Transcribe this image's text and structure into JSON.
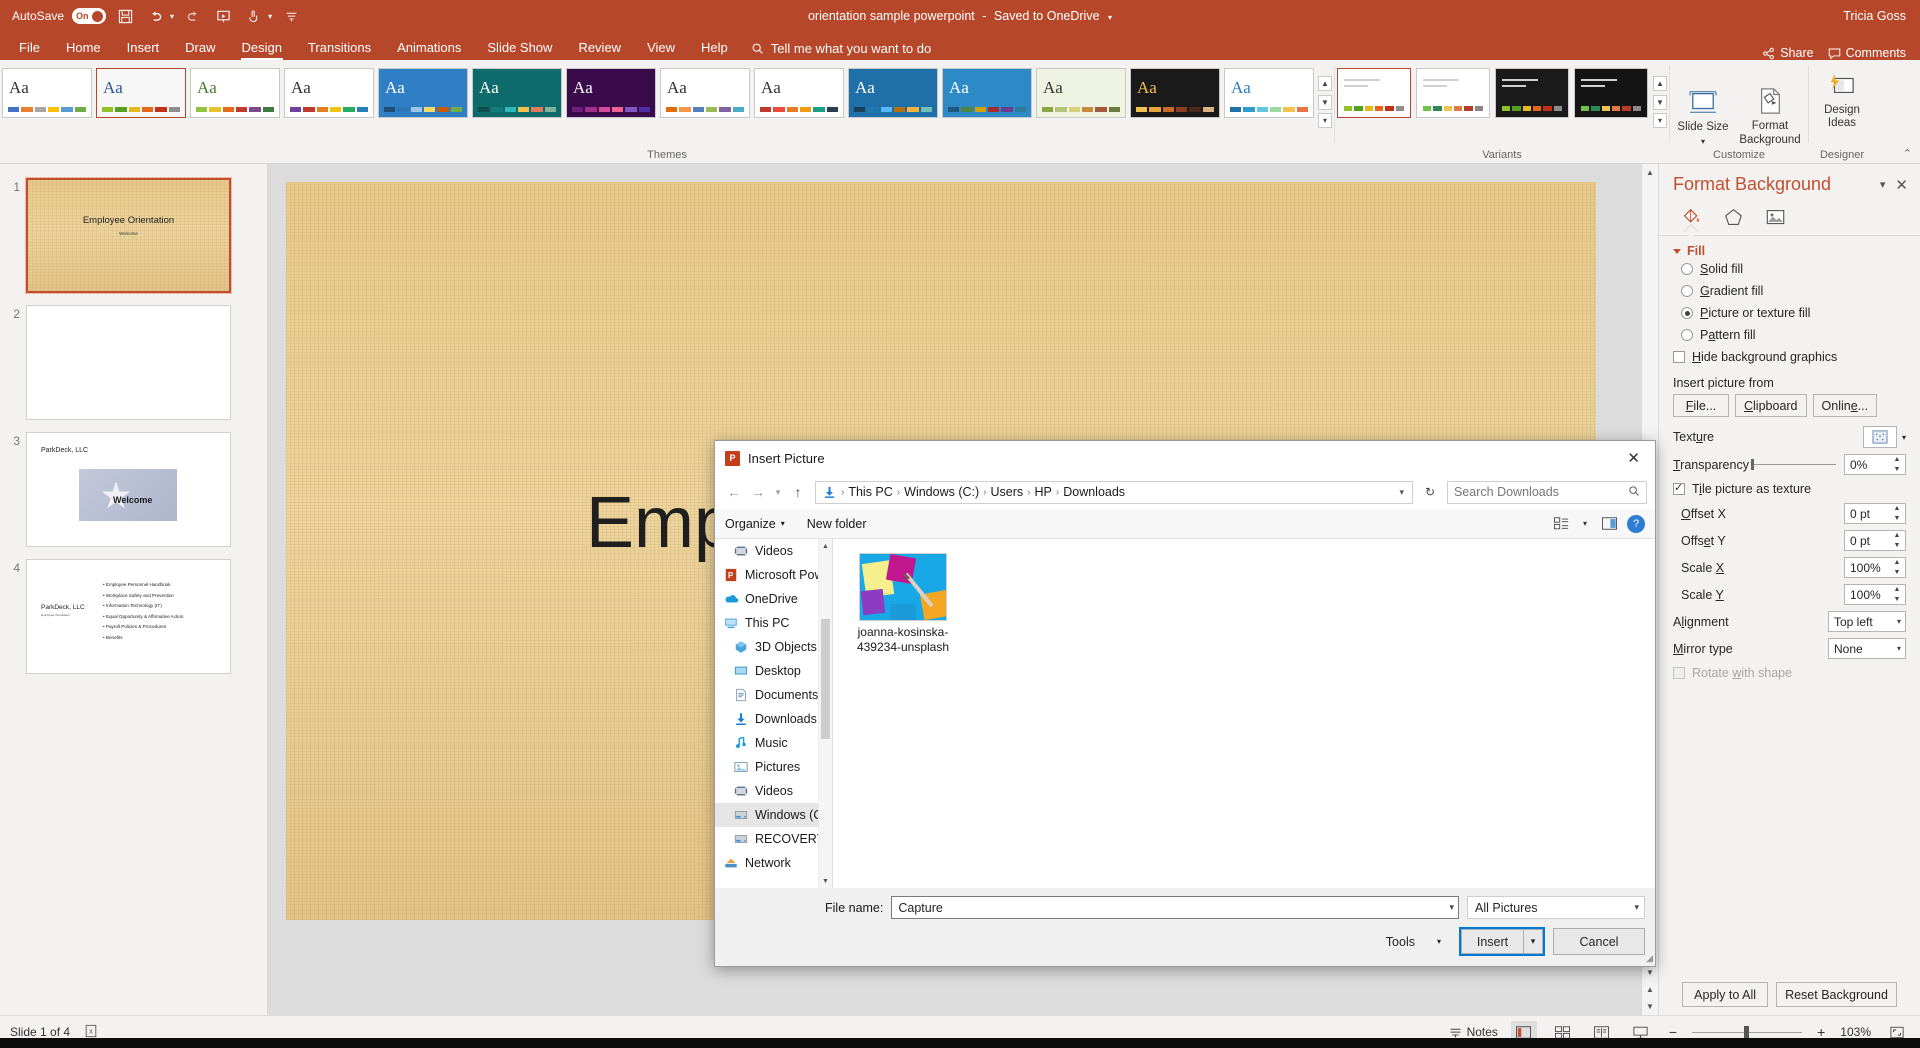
{
  "titlebar": {
    "autosave_label": "AutoSave",
    "autosave_state": "On",
    "document_title": "orientation sample powerpoint",
    "save_state": "Saved to OneDrive",
    "user_name": "Tricia Goss",
    "qat": [
      {
        "name": "save-icon",
        "glyph": "ὋE"
      },
      {
        "name": "undo-icon",
        "glyph": "↶"
      },
      {
        "name": "redo-icon",
        "glyph": "↻"
      },
      {
        "name": "start-presentation-icon",
        "glyph": "▣"
      },
      {
        "name": "touch-mode-icon",
        "glyph": "☝"
      },
      {
        "name": "customize-qat-icon",
        "glyph": "☰"
      }
    ]
  },
  "ribbon": {
    "tabs": [
      {
        "label": "File",
        "active": false
      },
      {
        "label": "Home",
        "active": false
      },
      {
        "label": "Insert",
        "active": false
      },
      {
        "label": "Draw",
        "active": false
      },
      {
        "label": "Design",
        "active": true
      },
      {
        "label": "Transitions",
        "active": false
      },
      {
        "label": "Animations",
        "active": false
      },
      {
        "label": "Slide Show",
        "active": false
      },
      {
        "label": "Review",
        "active": false
      },
      {
        "label": "View",
        "active": false
      },
      {
        "label": "Help",
        "active": false
      }
    ],
    "tellme_placeholder": "Tell me what you want to do",
    "share_label": "Share",
    "comments_label": "Comments",
    "groups": {
      "themes_label": "Themes",
      "variants_label": "Variants",
      "customize_label": "Customize",
      "designer_label": "Designer"
    },
    "buttons": {
      "slide_size": "Slide Size",
      "format_background": "Format Background",
      "design_ideas": "Design Ideas"
    },
    "themes": [
      {
        "name": "office-theme",
        "aa": "Aa",
        "bg": "#ffffff",
        "fg": "#333333",
        "colors": [
          "#4472c4",
          "#ed7d31",
          "#a5a5a5",
          "#ffc000",
          "#5b9bd5",
          "#70ad47"
        ],
        "selected": false
      },
      {
        "name": "facet-theme",
        "aa": "Aa",
        "bg": "#f7f7f7",
        "fg": "#2b579a",
        "colors": [
          "#90c226",
          "#54a021",
          "#e6b91e",
          "#e76618",
          "#c42f1a",
          "#918b8b"
        ],
        "selected": true
      },
      {
        "name": "berlin-theme",
        "aa": "Aa",
        "bg": "#ffffff",
        "fg": "#4a7a2c",
        "colors": [
          "#8ec63f",
          "#e8c32a",
          "#e56a19",
          "#c0392b",
          "#7a4b8c",
          "#3f7a3f"
        ],
        "selected": false
      },
      {
        "name": "celestial-theme",
        "aa": "Aa",
        "bg": "#ffffff",
        "fg": "#333333",
        "colors": [
          "#6f42a0",
          "#c0392b",
          "#e67e22",
          "#f1c40f",
          "#27ae60",
          "#2980b9"
        ],
        "selected": false
      },
      {
        "name": "dots-theme",
        "aa": "Aa",
        "bg": "#2f7ec6",
        "fg": "#ffffff",
        "colors": [
          "#1f4e79",
          "#2e75b6",
          "#9dc3e6",
          "#ffd966",
          "#c55a11",
          "#70ad47"
        ],
        "selected": false
      },
      {
        "name": "ion-theme",
        "aa": "Aa",
        "bg": "#0e6b6b",
        "fg": "#ffffff",
        "colors": [
          "#0f4c4c",
          "#157a7a",
          "#2fb8b8",
          "#f2c14e",
          "#e07a5f",
          "#81b29a"
        ],
        "selected": false
      },
      {
        "name": "ion-boardroom-theme",
        "aa": "Aa",
        "bg": "#3a0b4a",
        "fg": "#ffffff",
        "colors": [
          "#6b1f7a",
          "#a3308f",
          "#d94a9e",
          "#f06292",
          "#7e57c2",
          "#512da8"
        ],
        "selected": false
      },
      {
        "name": "retrospect-theme",
        "aa": "Aa",
        "bg": "#ffffff",
        "fg": "#333333",
        "colors": [
          "#e36c0a",
          "#f79646",
          "#4f81bd",
          "#9bbb59",
          "#8064a2",
          "#4bacc6"
        ],
        "selected": false
      },
      {
        "name": "slice-theme",
        "aa": "Aa",
        "bg": "#ffffff",
        "fg": "#333333",
        "colors": [
          "#c0392b",
          "#e74c3c",
          "#e67e22",
          "#f39c12",
          "#16a085",
          "#2c3e50"
        ],
        "selected": false
      },
      {
        "name": "wisp-theme",
        "aa": "Aa",
        "bg": "#1f6fa8",
        "fg": "#ffffff",
        "colors": [
          "#17405c",
          "#2176ae",
          "#57b8ff",
          "#b66d0d",
          "#fbb13c",
          "#73bfb8"
        ],
        "selected": false
      },
      {
        "name": "badge-theme",
        "aa": "Aa",
        "bg": "#2e8ac7",
        "fg": "#ffffff",
        "colors": [
          "#1b587c",
          "#4e8542",
          "#d2a300",
          "#a62b2b",
          "#6b3f8f",
          "#2c7d9b"
        ],
        "selected": false
      },
      {
        "name": "frame-theme",
        "aa": "Aa",
        "bg": "#eef3e2",
        "fg": "#333333",
        "colors": [
          "#8ba446",
          "#b5c47a",
          "#d8cf7a",
          "#c98a3f",
          "#a8583f",
          "#6a7b3f"
        ],
        "selected": false
      },
      {
        "name": "quotable-theme",
        "aa": "Aa",
        "bg": "#1a1a1a",
        "fg": "#f2c14e",
        "colors": [
          "#f2c14e",
          "#e8a33d",
          "#c96a2b",
          "#8c3d1f",
          "#4a2a16",
          "#d9b380"
        ],
        "selected": false
      },
      {
        "name": "vapor-trail-theme",
        "aa": "Aa",
        "bg": "#ffffff",
        "fg": "#2e7bb8",
        "colors": [
          "#1f6fa8",
          "#2e9ccc",
          "#64c7e0",
          "#9fd8a0",
          "#f2c14e",
          "#e8734a"
        ],
        "selected": false
      }
    ],
    "variants": [
      {
        "name": "variant-light-1",
        "bg": "#ffffff",
        "colors": [
          "#90c226",
          "#54a021",
          "#e6b91e",
          "#e76618",
          "#c42f1a",
          "#918b8b"
        ],
        "selected": true
      },
      {
        "name": "variant-light-2",
        "bg": "#ffffff",
        "colors": [
          "#6cc24a",
          "#2e8b57",
          "#f2c14e",
          "#e07a3f",
          "#b83b2a",
          "#8d8686"
        ],
        "selected": false
      },
      {
        "name": "variant-dark-1",
        "bg": "#1a1a1a",
        "colors": [
          "#90c226",
          "#54a021",
          "#e6b91e",
          "#e76618",
          "#c42f1a",
          "#918b8b"
        ],
        "selected": false
      },
      {
        "name": "variant-dark-2",
        "bg": "#141414",
        "colors": [
          "#6cc24a",
          "#2e8b57",
          "#f2c14e",
          "#e07a3f",
          "#b83b2a",
          "#8d8686"
        ],
        "selected": false
      }
    ]
  },
  "thumbnails": [
    {
      "number": "1",
      "kind": "title",
      "title": "Employee Orientation",
      "subtitle": "Welcome",
      "selected": true
    },
    {
      "number": "2",
      "kind": "blank",
      "title": "",
      "subtitle": "",
      "selected": false
    },
    {
      "number": "3",
      "kind": "image",
      "title": "ParkDeck, LLC",
      "image_label": "Welcome",
      "selected": false
    },
    {
      "number": "4",
      "kind": "bullets",
      "title": "ParkDeck, LLC",
      "subtitle": "Employee Orientation",
      "bullets": [
        "Employee Personnel Handbook",
        "Workplace Safety and Prevention",
        "Information Technology (IT)",
        "Equal Opportunity & Affirmative Action",
        "Payroll Policies & Procedures",
        "Benefits"
      ],
      "selected": false
    }
  ],
  "slide": {
    "title_visible_text": "Emp"
  },
  "dialog": {
    "title": "Insert Picture",
    "app_icon_label": "P",
    "close_label": "✕",
    "breadcrumbs": [
      "This PC",
      "Windows (C:)",
      "Users",
      "HP",
      "Downloads"
    ],
    "search_placeholder": "Search Downloads",
    "toolbar": {
      "organize": "Organize",
      "new_folder": "New folder",
      "help_label": "?"
    },
    "nav_items": [
      {
        "label": "Videos",
        "icon": "videos-icon",
        "indent": true,
        "selected": false
      },
      {
        "label": "Microsoft PowerP",
        "icon": "powerpoint-icon",
        "indent": false,
        "selected": false
      },
      {
        "label": "OneDrive",
        "icon": "onedrive-icon",
        "indent": false,
        "selected": false
      },
      {
        "label": "This PC",
        "icon": "this-pc-icon",
        "indent": false,
        "selected": false
      },
      {
        "label": "3D Objects",
        "icon": "3d-objects-icon",
        "indent": true,
        "selected": false
      },
      {
        "label": "Desktop",
        "icon": "desktop-icon",
        "indent": true,
        "selected": false
      },
      {
        "label": "Documents",
        "icon": "documents-icon",
        "indent": true,
        "selected": false
      },
      {
        "label": "Downloads",
        "icon": "downloads-icon",
        "indent": true,
        "selected": false
      },
      {
        "label": "Music",
        "icon": "music-icon",
        "indent": true,
        "selected": false
      },
      {
        "label": "Pictures",
        "icon": "pictures-icon",
        "indent": true,
        "selected": false
      },
      {
        "label": "Videos",
        "icon": "videos-icon",
        "indent": true,
        "selected": false
      },
      {
        "label": "Windows (C:)",
        "icon": "drive-icon",
        "indent": true,
        "selected": true
      },
      {
        "label": "RECOVERY (D:)",
        "icon": "drive-icon",
        "indent": true,
        "selected": false
      },
      {
        "label": "Network",
        "icon": "network-icon",
        "indent": false,
        "selected": false
      }
    ],
    "files": [
      {
        "name": "joanna-kosinska-439234-unsplash",
        "selected": true
      }
    ],
    "file_name_label": "File name:",
    "file_name_value": "Capture",
    "filter_value": "All Pictures",
    "tools_label": "Tools",
    "insert_label": "Insert",
    "cancel_label": "Cancel"
  },
  "format_background": {
    "title": "Format Background",
    "tabs": [
      {
        "name": "fill-tab",
        "label": "Fill",
        "active": true
      },
      {
        "name": "effects-tab",
        "label": "Effects",
        "active": false
      },
      {
        "name": "picture-tab",
        "label": "Picture",
        "active": false
      }
    ],
    "section_fill": "Fill",
    "fill_options": [
      {
        "label": "Solid fill",
        "accel": "S",
        "selected": false
      },
      {
        "label": "Gradient fill",
        "accel": "G",
        "selected": false
      },
      {
        "label": "Picture or texture fill",
        "accel": "P",
        "selected": true
      },
      {
        "label": "Pattern fill",
        "accel": "a",
        "selected": false
      }
    ],
    "hide_bg_graphics": {
      "label": "Hide background graphics",
      "checked": false
    },
    "insert_picture_from_label": "Insert picture from",
    "insert_buttons": [
      "File...",
      "Clipboard",
      "Online..."
    ],
    "texture_label": "Texture",
    "transparency_label": "Transparency",
    "transparency_value": "0%",
    "tile_label": "Tile picture as texture",
    "tile_checked": true,
    "fields": [
      {
        "label": "Offset X",
        "value": "0 pt",
        "type": "spin"
      },
      {
        "label": "Offset Y",
        "value": "0 pt",
        "type": "spin"
      },
      {
        "label": "Scale X",
        "value": "100%",
        "type": "spin"
      },
      {
        "label": "Scale Y",
        "value": "100%",
        "type": "spin"
      },
      {
        "label": "Alignment",
        "value": "Top left",
        "type": "combo"
      },
      {
        "label": "Mirror type",
        "value": "None",
        "type": "combo"
      }
    ],
    "rotate_with_shape": {
      "label": "Rotate with shape",
      "checked": false,
      "disabled": true
    },
    "apply_to_all": "Apply to All",
    "reset_background": "Reset Background"
  },
  "status_bar": {
    "slide_indicator": "Slide 1 of 4",
    "accessibility_icon": "accessibility-icon",
    "notes_label": "Notes",
    "views": [
      {
        "name": "normal-view-button",
        "active": true
      },
      {
        "name": "slide-sorter-button",
        "active": false
      },
      {
        "name": "reading-view-button",
        "active": false
      },
      {
        "name": "slideshow-button",
        "active": false
      }
    ],
    "zoom_out": "−",
    "zoom_in": "+",
    "zoom_level": "103%",
    "fit_label": "fit-to-window-icon"
  }
}
